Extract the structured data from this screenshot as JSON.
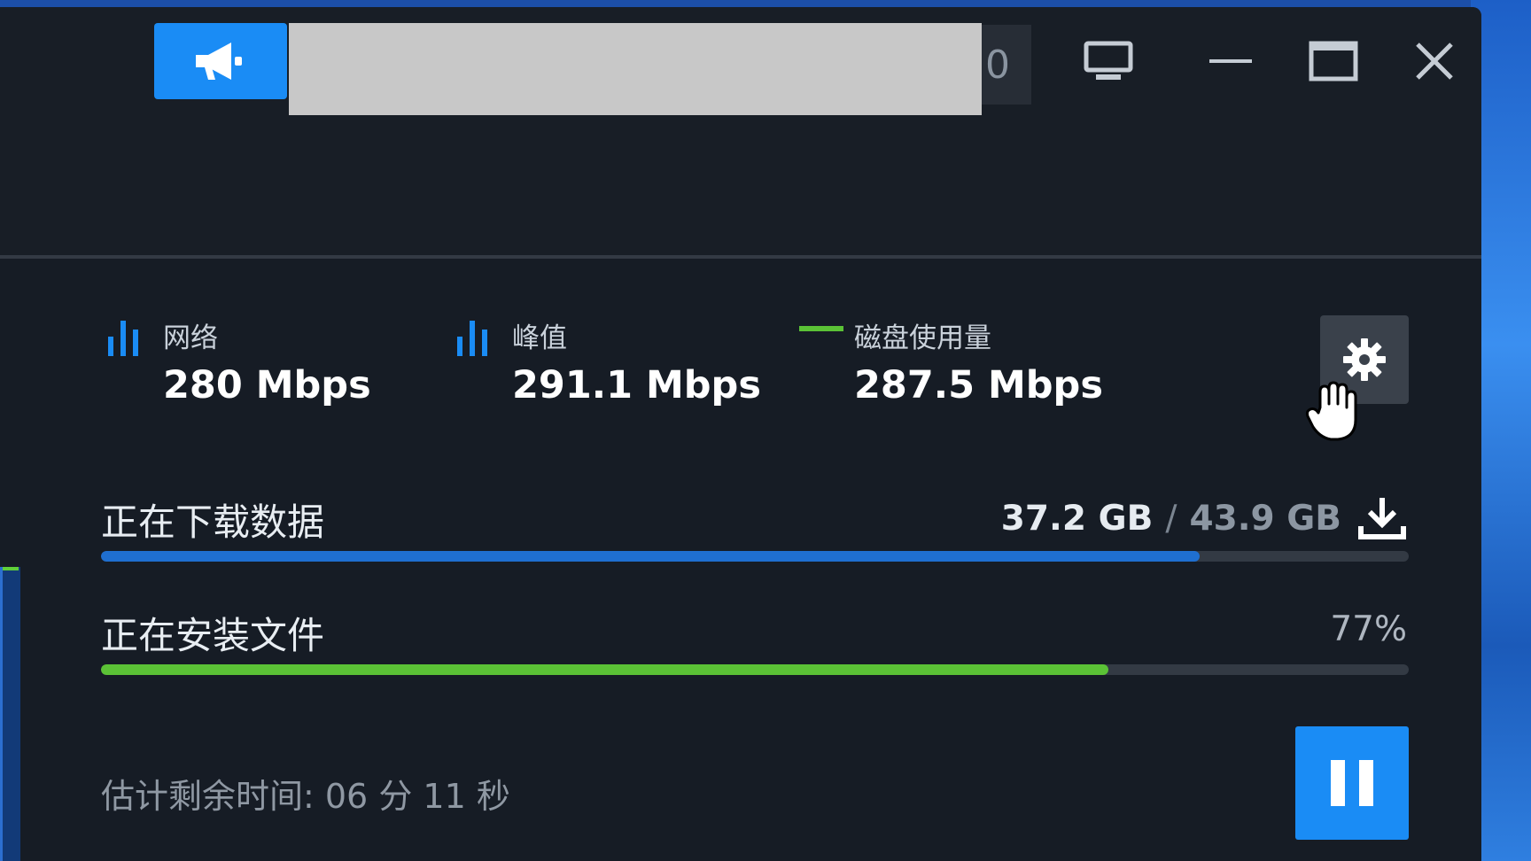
{
  "stats": [
    {
      "label": "网络",
      "value": "280 Mbps",
      "icon": "bar-chart-icon"
    },
    {
      "label": "峰值",
      "value": "291.1 Mbps",
      "icon": "bar-chart-icon"
    },
    {
      "label": "磁盘使用量",
      "value": "287.5 Mbps",
      "icon": "line-legend-icon"
    }
  ],
  "titlebar": {
    "partial_text": "0"
  },
  "download": {
    "label": "正在下载数据",
    "current": "37.2 GB",
    "separator": "/",
    "total": "43.9 GB",
    "progress": 0.84
  },
  "install": {
    "label": "正在安装文件",
    "percent_text": "77%",
    "progress": 0.77
  },
  "eta": {
    "text": "估计剩余时间: 06 分 11 秒"
  },
  "colors": {
    "accent_blue": "#1a8cf5",
    "download_bar": "#1f6fd0",
    "install_bar": "#5bc236",
    "disk_legend": "#5bc236",
    "window_bg": "#161c25"
  },
  "icons": {
    "announce": "megaphone-icon",
    "monitor": "monitor-icon",
    "minimize": "minimize-icon",
    "maximize": "maximize-icon",
    "close": "close-icon",
    "settings": "gear-icon",
    "download": "download-icon",
    "pause": "pause-icon",
    "cursor": "hand-cursor-icon"
  }
}
